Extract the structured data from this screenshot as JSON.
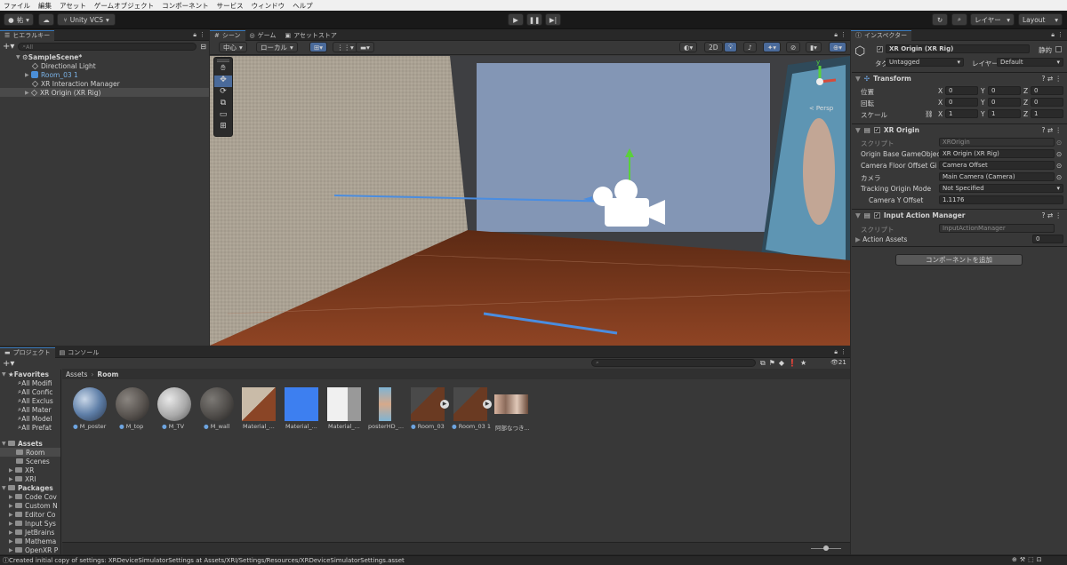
{
  "menu": [
    "ファイル",
    "編集",
    "アセット",
    "ゲームオブジェクト",
    "コンポーネント",
    "サービス",
    "ウィンドウ",
    "ヘルプ"
  ],
  "toolbar": {
    "account": "祐",
    "vcs": "Unity VCS",
    "layers": "レイヤー",
    "layout": "Layout"
  },
  "hierarchy": {
    "tab": "ヒエラルキー",
    "search_placeholder": "All",
    "scene": "SampleScene*",
    "items": [
      "Directional Light",
      "Room_03 1",
      "XR Interaction Manager",
      "XR Origin (XR Rig)"
    ]
  },
  "scene_tabs": [
    "シーン",
    "ゲーム",
    "アセットストア"
  ],
  "scene_toolbar": {
    "pivot": "中心",
    "space": "ローカル",
    "mode2d": "2D",
    "persp": "< Persp"
  },
  "inspector": {
    "tab": "インスペクター",
    "object_name": "XR Origin (XR Rig)",
    "static": "静的",
    "tag_label": "タグ",
    "tag": "Untagged",
    "layer_label": "レイヤー",
    "layer": "Default",
    "transform": {
      "title": "Transform",
      "pos": "位置",
      "rot": "回転",
      "scale": "スケール",
      "x": "X",
      "y": "Y",
      "z": "Z",
      "pos_v": [
        "0",
        "0",
        "0"
      ],
      "rot_v": [
        "0",
        "0",
        "0"
      ],
      "scale_v": [
        "1",
        "1",
        "1"
      ]
    },
    "xr_origin": {
      "title": "XR Origin",
      "script_label": "スクリプト",
      "script": "XROrigin",
      "f1": "Origin Base GameObjec",
      "v1": "XR Origin (XR Rig)",
      "f2": "Camera Floor Offset Gi",
      "v2": "Camera Offset",
      "f3": "カメラ",
      "v3": "Main Camera (Camera)",
      "f4": "Tracking Origin Mode",
      "v4": "Not Specified",
      "f5": "Camera Y Offset",
      "v5": "1.1176"
    },
    "input_action": {
      "title": "Input Action Manager",
      "script_label": "スクリプト",
      "script": "InputActionManager",
      "f1": "Action Assets",
      "v1": "0"
    },
    "add_component": "コンポーネントを追加"
  },
  "project": {
    "tab_project": "プロジェクト",
    "tab_console": "コンソール",
    "count": "21",
    "breadcrumb_root": "Assets",
    "breadcrumb_sep": "›",
    "breadcrumb_leaf": "Room",
    "favorites_title": "Favorites",
    "favorites": [
      "All Modifi",
      "All Confic",
      "All Exclus",
      "All Mater",
      "All Model",
      "All Prefat"
    ],
    "assets_title": "Assets",
    "assets_folders": [
      "Room",
      "Scenes",
      "XR",
      "XRI"
    ],
    "packages_title": "Packages",
    "packages": [
      "Code Cov",
      "Custom N",
      "Editor Co",
      "Input Sys",
      "JetBrains",
      "Mathema",
      "OpenXR P"
    ],
    "items": [
      "M_poster",
      "M_top",
      "M_TV",
      "M_wall",
      "Material_...",
      "Material_...",
      "Material_...",
      "posterHD_...",
      "Room_03",
      "Room_03 1",
      "阿部なつき..."
    ]
  },
  "status": "Created initial copy of settings: XRDeviceSimulatorSettings at Assets/XRI/Settings/Resources/XRDeviceSimulatorSettings.asset"
}
